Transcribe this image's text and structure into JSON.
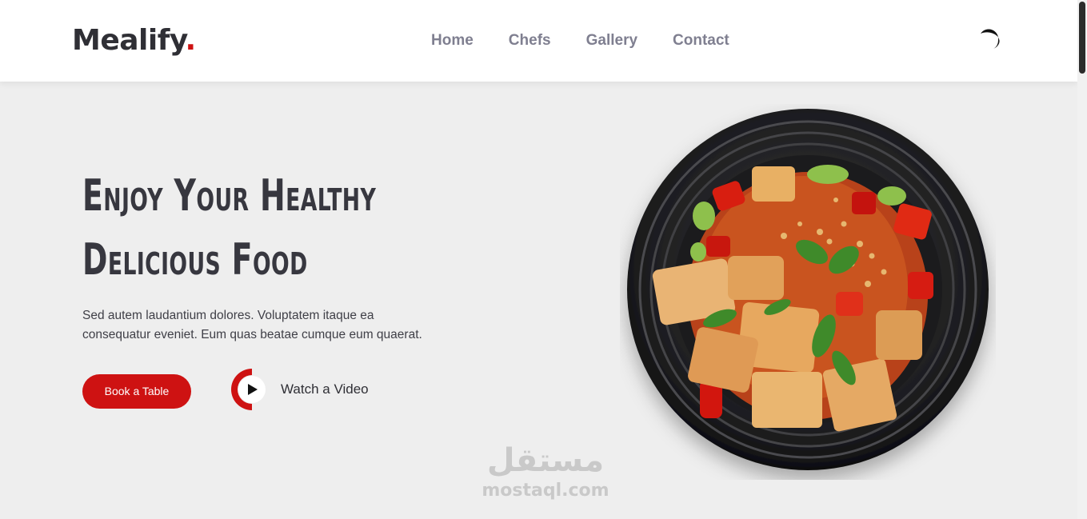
{
  "header": {
    "logo": "Mealify",
    "logo_dot": ".",
    "nav": [
      "Home",
      "Chefs",
      "Gallery",
      "Contact"
    ]
  },
  "hero": {
    "title_line1": "Enjoy Your Healthy",
    "title_line2": "Delicious Food",
    "description_line1": "Sed autem laudantium dolores. Voluptatem itaque ea",
    "description_line2": "consequatur eveniet. Eum quas beatae cumque eum quaerat.",
    "book_button": "Book a Table",
    "watch_label": "Watch a Video"
  },
  "watermark": {
    "arabic": "مستقل",
    "latin": "mostaql.com"
  },
  "colors": {
    "accent": "#ce1212",
    "text_dark": "#37373f",
    "nav": "#7f7f90",
    "background": "#eeeeee"
  },
  "icons": {
    "loader": "spinner-icon",
    "play": "play-icon"
  }
}
